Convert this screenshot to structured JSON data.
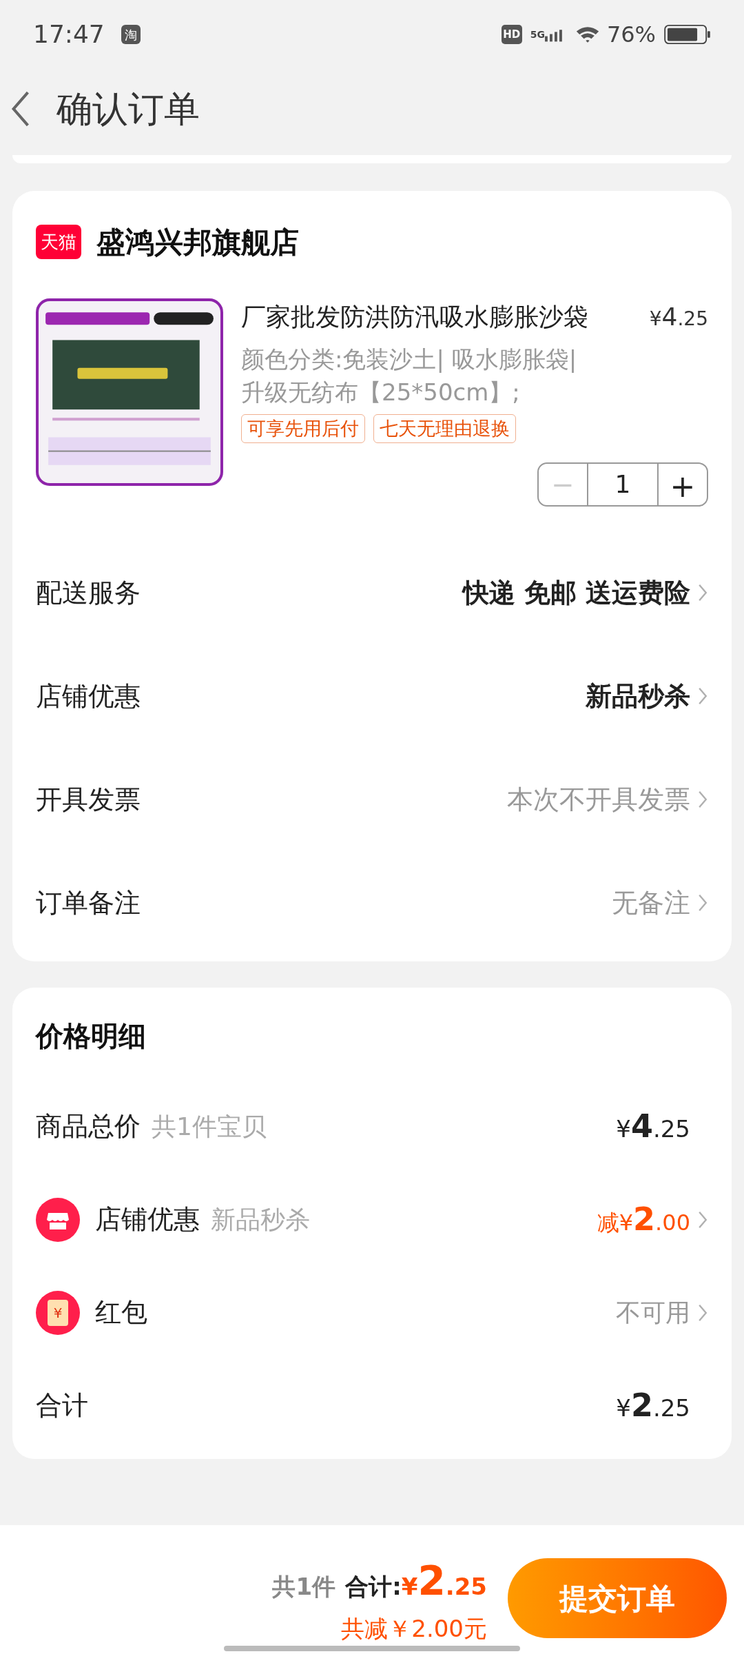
{
  "status_bar": {
    "time": "17:47",
    "app_badge": "淘",
    "hd_badge": "HD",
    "network": "5G",
    "battery_percent": "76%"
  },
  "header": {
    "title": "确认订单"
  },
  "store": {
    "badge": "天猫",
    "name": "盛鸿兴邦旗舰店",
    "product": {
      "title": "厂家批发防洪防汛吸水膨胀沙袋",
      "price": {
        "symbol": "¥",
        "integer": "4",
        "decimal": ".25"
      },
      "spec": "颜色分类:免装沙土| 吸水膨胀袋|升级无纺布【25*50cm】;",
      "tags": [
        "可享先用后付",
        "七天无理由退换"
      ],
      "quantity": {
        "minus": "−",
        "value": "1",
        "plus": "+",
        "minus_disabled": true
      }
    },
    "options": [
      {
        "label": "配送服务",
        "value": "快递 免邮 送运费险",
        "emphasis": true
      },
      {
        "label": "店铺优惠",
        "value": "新品秒杀",
        "emphasis": true
      },
      {
        "label": "开具发票",
        "value": "本次不开具发票",
        "emphasis": false
      },
      {
        "label": "订单备注",
        "value": "无备注",
        "emphasis": false
      }
    ]
  },
  "price_detail": {
    "title": "价格明细",
    "rows": [
      {
        "kind": "plain",
        "label": "商品总价",
        "note": "共1件宝贝",
        "amount": {
          "symbol": "¥",
          "integer": "4",
          "decimal": ".25"
        }
      },
      {
        "kind": "shop",
        "label": "店铺优惠",
        "note": "新品秒杀",
        "prefix": "减",
        "amount": {
          "symbol": "¥",
          "integer": "2",
          "decimal": ".00"
        },
        "arrow": true
      },
      {
        "kind": "redpacket",
        "icon_text": "¥",
        "label": "红包",
        "value": "不可用",
        "arrow": true
      },
      {
        "kind": "plain",
        "label": "合计",
        "amount": {
          "symbol": "¥",
          "integer": "2",
          "decimal": ".25"
        }
      }
    ]
  },
  "bottom_bar": {
    "count": "共1件",
    "total_label": "合计:",
    "total": {
      "symbol": "¥",
      "integer": "2",
      "decimal": ".25"
    },
    "saved": "共减￥2.00元",
    "submit": "提交订单"
  }
}
